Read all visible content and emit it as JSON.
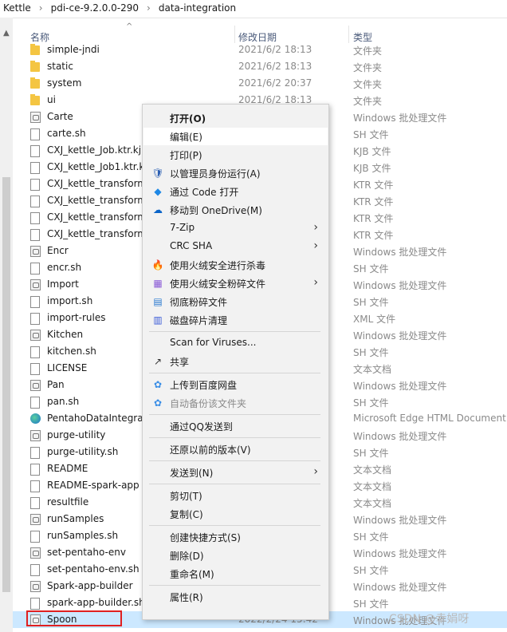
{
  "breadcrumb": [
    "Kettle",
    "pdi-ce-9.2.0.0-290",
    "data-integration"
  ],
  "columns": {
    "name": "名称",
    "date": "修改日期",
    "type": "类型"
  },
  "files": [
    {
      "name": "simple-jndi",
      "date": "2021/6/2 18:13",
      "type": "文件夹",
      "icon": "folder-icon"
    },
    {
      "name": "static",
      "date": "2021/6/2 18:13",
      "type": "文件夹",
      "icon": "folder-icon"
    },
    {
      "name": "system",
      "date": "2021/6/2 20:37",
      "type": "文件夹",
      "icon": "folder-icon"
    },
    {
      "name": "ui",
      "date": "2021/6/2 18:13",
      "type": "文件夹",
      "icon": "folder-icon"
    },
    {
      "name": "Carte",
      "date": "",
      "type": "Windows 批处理文件",
      "icon": "batch-file-icon"
    },
    {
      "name": "carte.sh",
      "date": "",
      "type": "SH 文件",
      "icon": "file-icon"
    },
    {
      "name": "CXJ_kettle_Job.ktr.kjb",
      "date": "",
      "type": "KJB 文件",
      "icon": "file-icon"
    },
    {
      "name": "CXJ_kettle_Job1.ktr.kjb",
      "date": "",
      "type": "KJB 文件",
      "icon": "file-icon"
    },
    {
      "name": "CXJ_kettle_transform",
      "date": "",
      "type": "KTR 文件",
      "icon": "file-icon"
    },
    {
      "name": "CXJ_kettle_transform",
      "date": "",
      "type": "KTR 文件",
      "icon": "file-icon"
    },
    {
      "name": "CXJ_kettle_transform",
      "date": "",
      "type": "KTR 文件",
      "icon": "file-icon"
    },
    {
      "name": "CXJ_kettle_transform",
      "date": "",
      "type": "KTR 文件",
      "icon": "file-icon"
    },
    {
      "name": "Encr",
      "date": "",
      "type": "Windows 批处理文件",
      "icon": "batch-file-icon"
    },
    {
      "name": "encr.sh",
      "date": "",
      "type": "SH 文件",
      "icon": "file-icon"
    },
    {
      "name": "Import",
      "date": "",
      "type": "Windows 批处理文件",
      "icon": "batch-file-icon"
    },
    {
      "name": "import.sh",
      "date": "",
      "type": "SH 文件",
      "icon": "file-icon"
    },
    {
      "name": "import-rules",
      "date": "",
      "type": "XML 文件",
      "icon": "file-icon"
    },
    {
      "name": "Kitchen",
      "date": "",
      "type": "Windows 批处理文件",
      "icon": "batch-file-icon"
    },
    {
      "name": "kitchen.sh",
      "date": "",
      "type": "SH 文件",
      "icon": "file-icon"
    },
    {
      "name": "LICENSE",
      "date": "",
      "type": "文本文档",
      "icon": "text-file-icon"
    },
    {
      "name": "Pan",
      "date": "",
      "type": "Windows 批处理文件",
      "icon": "batch-file-icon"
    },
    {
      "name": "pan.sh",
      "date": "",
      "type": "SH 文件",
      "icon": "file-icon"
    },
    {
      "name": "PentahoDataIntegration",
      "date": "",
      "type": "Microsoft Edge HTML Document",
      "icon": "edge-icon"
    },
    {
      "name": "purge-utility",
      "date": "",
      "type": "Windows 批处理文件",
      "icon": "batch-file-icon"
    },
    {
      "name": "purge-utility.sh",
      "date": "",
      "type": "SH 文件",
      "icon": "file-icon"
    },
    {
      "name": "README",
      "date": "",
      "type": "文本文档",
      "icon": "text-file-icon"
    },
    {
      "name": "README-spark-app",
      "date": "",
      "type": "文本文档",
      "icon": "text-file-icon"
    },
    {
      "name": "resultfile",
      "date": "",
      "type": "文本文档",
      "icon": "text-file-icon"
    },
    {
      "name": "runSamples",
      "date": "",
      "type": "Windows 批处理文件",
      "icon": "batch-file-icon"
    },
    {
      "name": "runSamples.sh",
      "date": "",
      "type": "SH 文件",
      "icon": "file-icon"
    },
    {
      "name": "set-pentaho-env",
      "date": "",
      "type": "Windows 批处理文件",
      "icon": "batch-file-icon"
    },
    {
      "name": "set-pentaho-env.sh",
      "date": "",
      "type": "SH 文件",
      "icon": "file-icon"
    },
    {
      "name": "Spark-app-builder",
      "date": "",
      "type": "Windows 批处理文件",
      "icon": "batch-file-icon"
    },
    {
      "name": "spark-app-builder.sh",
      "date": "",
      "type": "SH 文件",
      "icon": "file-icon"
    },
    {
      "name": "Spoon",
      "date": "2022/2/24 15:42",
      "type": "Windows 批处理文件",
      "icon": "batch-file-icon",
      "selected": true
    }
  ],
  "context_menu": [
    {
      "label": "打开(O)",
      "bold": true,
      "icon": "",
      "sub": false
    },
    {
      "label": "编辑(E)",
      "icon": "",
      "sub": false,
      "highlight": true
    },
    {
      "label": "打印(P)",
      "icon": "",
      "sub": false
    },
    {
      "label": "以管理员身份运行(A)",
      "icon": "shield-icon",
      "sub": false
    },
    {
      "label": "通过 Code 打开",
      "icon": "vscode-icon",
      "sub": false
    },
    {
      "label": "移动到 OneDrive(M)",
      "icon": "onedrive-icon",
      "sub": false
    },
    {
      "label": "7-Zip",
      "icon": "",
      "sub": true
    },
    {
      "label": "CRC SHA",
      "icon": "",
      "sub": true
    },
    {
      "label": "使用火绒安全进行杀毒",
      "icon": "huorong-icon",
      "sub": false
    },
    {
      "label": "使用火绒安全粉碎文件",
      "icon": "shredder-icon",
      "sub": true
    },
    {
      "label": "彻底粉碎文件",
      "icon": "shred-icon",
      "sub": false
    },
    {
      "label": "磁盘碎片清理",
      "icon": "disk-clean-icon",
      "sub": false
    },
    {
      "sep": true
    },
    {
      "label": "Scan for Viruses...",
      "icon": "",
      "sub": false
    },
    {
      "label": "共享",
      "icon": "share-icon",
      "sub": false
    },
    {
      "sep": true
    },
    {
      "label": "上传到百度网盘",
      "icon": "baidu-cloud-icon",
      "sub": false
    },
    {
      "label": "自动备份该文件夹",
      "icon": "baidu-cloud-icon",
      "sub": false,
      "disabled": true
    },
    {
      "sep": true
    },
    {
      "label": "通过QQ发送到",
      "icon": "",
      "sub": false
    },
    {
      "sep": true
    },
    {
      "label": "还原以前的版本(V)",
      "icon": "",
      "sub": false
    },
    {
      "sep": true
    },
    {
      "label": "发送到(N)",
      "icon": "",
      "sub": true
    },
    {
      "sep": true
    },
    {
      "label": "剪切(T)",
      "icon": "",
      "sub": false
    },
    {
      "label": "复制(C)",
      "icon": "",
      "sub": false
    },
    {
      "sep": true
    },
    {
      "label": "创建快捷方式(S)",
      "icon": "",
      "sub": false
    },
    {
      "label": "删除(D)",
      "icon": "",
      "sub": false
    },
    {
      "label": "重命名(M)",
      "icon": "",
      "sub": false
    },
    {
      "sep": true
    },
    {
      "label": "属性(R)",
      "icon": "",
      "sub": false
    }
  ],
  "watermark": "CSDN @幸娟呀",
  "colors": {
    "selection": "#cce8ff",
    "highlight_box": "#d0202a"
  }
}
